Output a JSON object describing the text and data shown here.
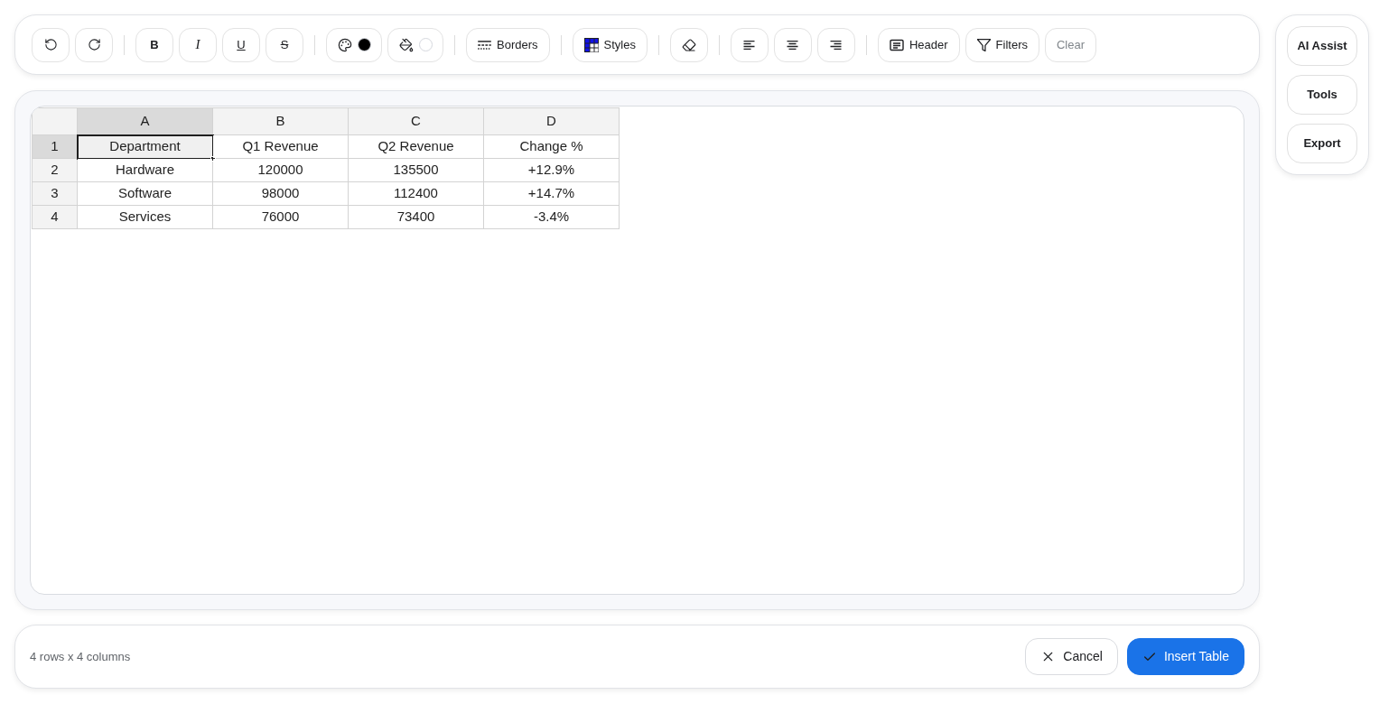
{
  "toolbar": {
    "groups": [
      [
        {
          "kind": "undo",
          "disabled": false
        },
        {
          "kind": "redo",
          "disabled": false
        }
      ],
      [
        {
          "kind": "bold",
          "label": "B",
          "disabled": false
        },
        {
          "kind": "italic",
          "label": "I",
          "disabled": false
        },
        {
          "kind": "underline",
          "label": "U",
          "disabled": false
        },
        {
          "kind": "strikethrough",
          "label": "S",
          "disabled": false
        }
      ],
      [
        {
          "kind": "text_color",
          "color": "#000000",
          "disabled": false
        },
        {
          "kind": "fill_color",
          "color": "#ffffff",
          "disabled": false
        }
      ],
      [
        {
          "kind": "borders",
          "label": "Borders",
          "disabled": false
        }
      ],
      [
        {
          "kind": "styles",
          "label": "Styles",
          "disabled": false
        }
      ],
      [
        {
          "kind": "eraser",
          "disabled": false
        }
      ],
      [
        {
          "kind": "align_left",
          "disabled": false
        },
        {
          "kind": "align_center",
          "disabled": false
        },
        {
          "kind": "align_right",
          "disabled": false
        }
      ],
      [
        {
          "kind": "header",
          "label": "Header",
          "disabled": false
        },
        {
          "kind": "filters",
          "label": "Filters",
          "disabled": false
        },
        {
          "kind": "clear",
          "label": "Clear",
          "disabled": true
        }
      ]
    ]
  },
  "side_panel": {
    "buttons": [
      "AI Assist",
      "Tools",
      "Export"
    ]
  },
  "sheet": {
    "columns": [
      {
        "label": "A",
        "selected": true
      },
      {
        "label": "B",
        "selected": false
      },
      {
        "label": "C",
        "selected": false
      },
      {
        "label": "D",
        "selected": false
      }
    ],
    "rows": [
      {
        "label": "1",
        "selected": true,
        "cells": [
          {
            "text": "Department",
            "selected": true
          },
          {
            "text": "Q1 Revenue",
            "selected": false
          },
          {
            "text": "Q2 Revenue",
            "selected": false
          },
          {
            "text": "Change %",
            "selected": false
          }
        ]
      },
      {
        "label": "2",
        "selected": false,
        "cells": [
          {
            "text": "Hardware",
            "selected": false
          },
          {
            "text": "120000",
            "selected": false
          },
          {
            "text": "135500",
            "selected": false
          },
          {
            "text": "+12.9%",
            "selected": false
          }
        ]
      },
      {
        "label": "3",
        "selected": false,
        "cells": [
          {
            "text": "Software",
            "selected": false
          },
          {
            "text": "98000",
            "selected": false
          },
          {
            "text": "112400",
            "selected": false
          },
          {
            "text": "+14.7%",
            "selected": false
          }
        ]
      },
      {
        "label": "4",
        "selected": false,
        "cells": [
          {
            "text": "Services",
            "selected": false
          },
          {
            "text": "76000",
            "selected": false
          },
          {
            "text": "73400",
            "selected": false
          },
          {
            "text": "-3.4%",
            "selected": false
          }
        ]
      }
    ]
  },
  "status_bar": {
    "summary": "4 rows x 4 columns",
    "buttons": [
      {
        "kind": "secondary",
        "label": "Cancel"
      },
      {
        "kind": "primary",
        "label": "Insert Table"
      }
    ]
  }
}
